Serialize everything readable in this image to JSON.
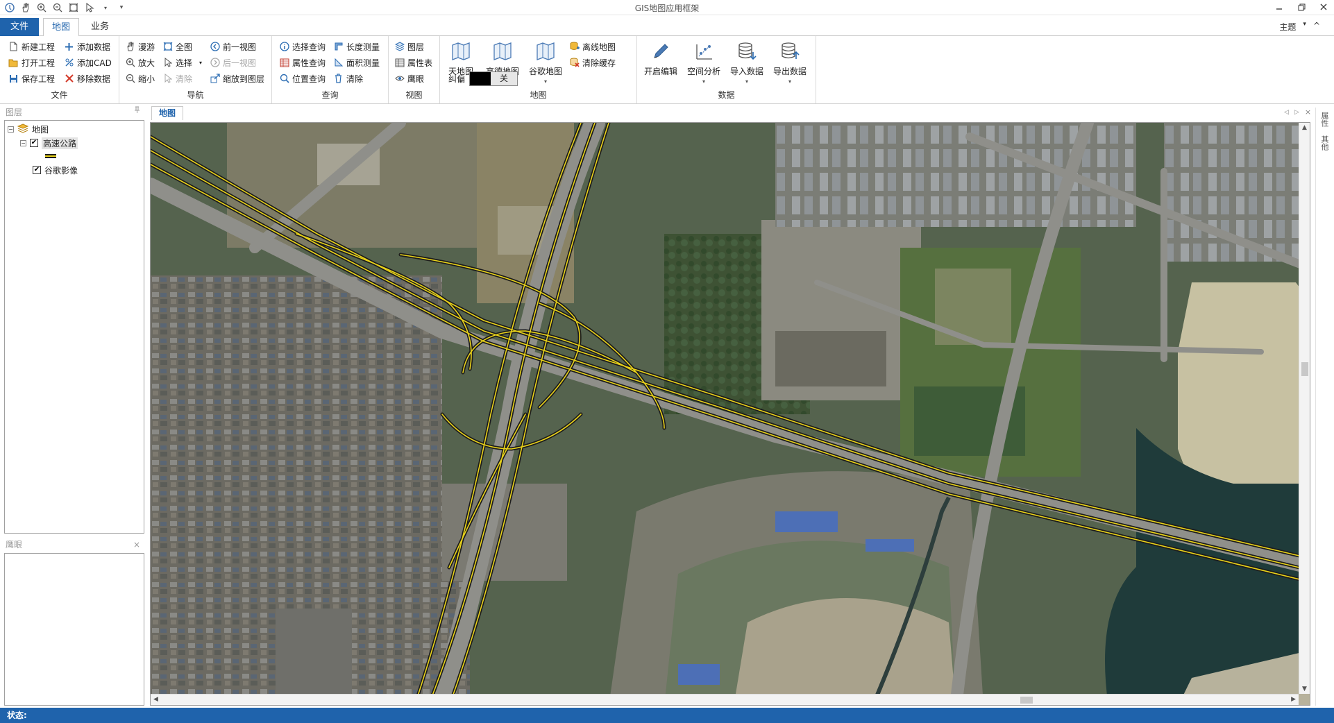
{
  "window": {
    "title": "GIS地图应用框架"
  },
  "quick_access": [
    "app-icon",
    "pan-hand-icon",
    "zoom-in-icon",
    "zoom-out-icon",
    "full-extent-icon",
    "select-arrow-icon",
    "dropdown-icon",
    "customize-icon"
  ],
  "tabs": {
    "file": "文件",
    "map": "地图",
    "business": "业务"
  },
  "theme": {
    "label": "主题",
    "arrow": "▾",
    "collapse": "^"
  },
  "ribbon": {
    "file_group": {
      "label": "文件",
      "new": "新建工程",
      "open": "打开工程",
      "save": "保存工程",
      "add_data": "添加数据",
      "add_cad": "添加CAD",
      "remove_data": "移除数据"
    },
    "nav_group": {
      "label": "导航",
      "roam": "漫游",
      "zoom_in": "放大",
      "zoom_out": "缩小",
      "full": "全图",
      "select": "选择",
      "clear": "清除",
      "prev_view": "前一视图",
      "next_view": "后一视图",
      "zoom_to_layer": "缩放到图层"
    },
    "query_group": {
      "label": "查询",
      "select_query": "选择查询",
      "attr_query": "属性查询",
      "loc_query": "位置查询",
      "length": "长度测量",
      "area": "面积测量",
      "clear": "清除"
    },
    "view_group": {
      "label": "视图",
      "layers": "图层",
      "attr_table": "属性表",
      "eagle": "鹰眼"
    },
    "map_group": {
      "label": "地图",
      "tianditu": "天地图",
      "gaode": "高德地图",
      "google": "谷歌地图",
      "offline": "离线地图",
      "clear_cache": "清除缓存",
      "offset": "纠偏",
      "offset_state": "关"
    },
    "data_group": {
      "label": "数据",
      "edit": "开启编辑",
      "spatial": "空间分析",
      "import": "导入数据",
      "export": "导出数据"
    }
  },
  "layers_panel": {
    "title": "图层",
    "pin": "ᵖ",
    "root": "地图",
    "items": [
      {
        "name": "高速公路",
        "checked": true
      },
      {
        "name": "谷歌影像",
        "checked": true
      }
    ]
  },
  "eagle_panel": {
    "title": "鹰眼",
    "close": "×"
  },
  "map_doc": {
    "tab": "地图"
  },
  "right_strip": {
    "a": "属性",
    "b": "其他"
  },
  "status": {
    "label": "状态:"
  },
  "colors": {
    "accent": "#1f63ac",
    "road_line": "#e8d21a",
    "road_casing": "#1c1c1c",
    "imagery": "#4e5b48"
  }
}
